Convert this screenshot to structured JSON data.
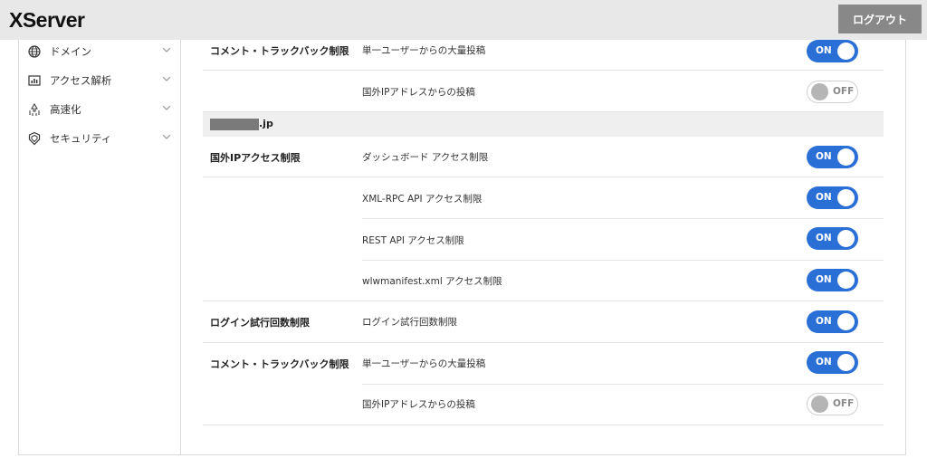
{
  "header": {
    "logo": "XServer",
    "logout_label": "ログアウト"
  },
  "sidebar": {
    "items": [
      {
        "label": "ドメイン",
        "icon": "globe-icon"
      },
      {
        "label": "アクセス解析",
        "icon": "chart-icon"
      },
      {
        "label": "高速化",
        "icon": "speed-icon"
      },
      {
        "label": "セキュリティ",
        "icon": "shield-icon"
      }
    ]
  },
  "top_section": {
    "group": "コメント・トラックバック制限",
    "items": [
      {
        "label": "単一ユーザーからの大量投稿",
        "state": "ON"
      },
      {
        "label": "国外IPアドレスからの投稿",
        "state": "OFF"
      }
    ]
  },
  "domain": {
    "suffix": ".jp"
  },
  "domain_section": {
    "groups": [
      {
        "label": "国外IPアクセス制限",
        "items": [
          {
            "label": "ダッシュボード アクセス制限",
            "state": "ON"
          },
          {
            "label": "XML-RPC API アクセス制限",
            "state": "ON"
          },
          {
            "label": "REST API アクセス制限",
            "state": "ON"
          },
          {
            "label": "wlwmanifest.xml アクセス制限",
            "state": "ON"
          }
        ]
      },
      {
        "label": "ログイン試行回数制限",
        "items": [
          {
            "label": "ログイン試行回数制限",
            "state": "ON"
          }
        ]
      },
      {
        "label": "コメント・トラックバック制限",
        "items": [
          {
            "label": "単一ユーザーからの大量投稿",
            "state": "ON"
          },
          {
            "label": "国外IPアドレスからの投稿",
            "state": "OFF"
          }
        ]
      }
    ]
  },
  "colors": {
    "toggle_on": "#2a6fd6",
    "toggle_off_knob": "#b5b5b5",
    "logout_bg": "#888888",
    "header_bg": "#e8e8e8"
  }
}
